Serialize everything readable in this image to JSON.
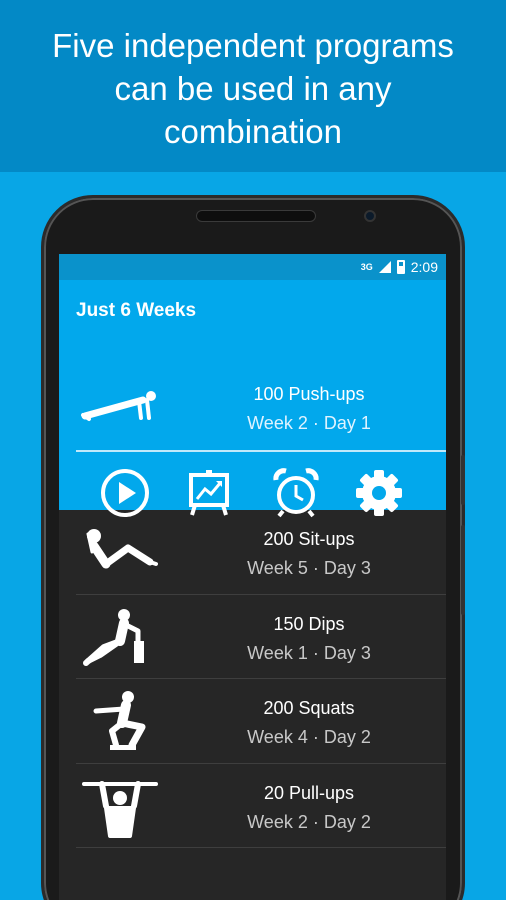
{
  "banner": {
    "line1": "Five independent programs",
    "line2": "can be used in any",
    "line3": "combination"
  },
  "status_bar": {
    "network": "3G",
    "time": "2:09"
  },
  "app": {
    "title": "Just 6 Weeks"
  },
  "active_program": {
    "name": "100 Push-ups",
    "progress": "Week 2 · Day 1",
    "icon": "pushup-figure-icon"
  },
  "actions": [
    {
      "icon": "play-icon"
    },
    {
      "icon": "stats-chart-icon"
    },
    {
      "icon": "alarm-clock-icon"
    },
    {
      "icon": "gear-icon"
    }
  ],
  "programs": [
    {
      "name": "200 Sit-ups",
      "progress": "Week 5 · Day 3",
      "icon": "situp-figure-icon"
    },
    {
      "name": "150 Dips",
      "progress": "Week 1 · Day 3",
      "icon": "dips-figure-icon"
    },
    {
      "name": "200 Squats",
      "progress": "Week 4 · Day 2",
      "icon": "squat-figure-icon"
    },
    {
      "name": "20 Pull-ups",
      "progress": "Week 2 · Day 2",
      "icon": "pullup-figure-icon"
    }
  ],
  "colors": {
    "background": "#08a6e6",
    "banner": "#0389c6",
    "active_card": "#02a8ec",
    "list_background": "#262626"
  }
}
